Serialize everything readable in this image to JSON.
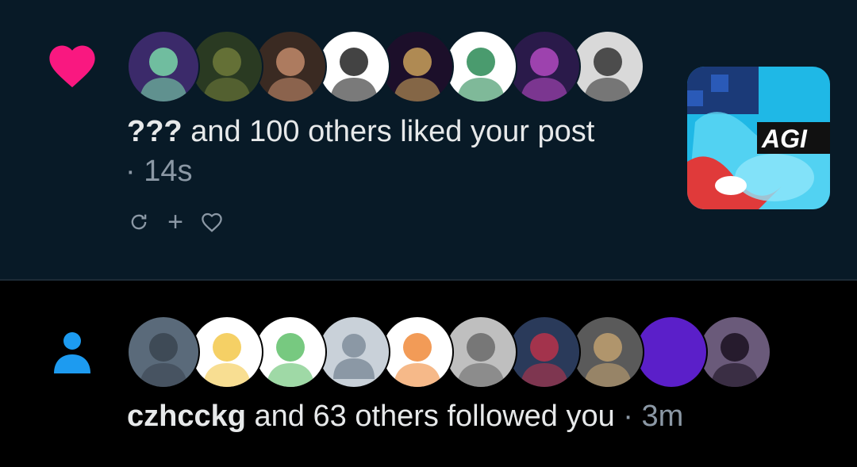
{
  "like_notification": {
    "actor": "???",
    "message": "and 100 others liked your post",
    "time": "· 14s",
    "actions": {
      "repost": "↻",
      "add": "+",
      "like": "♡"
    },
    "avatars": [
      {
        "icon": "avatar-ghost-witch",
        "bg": "#3b2a6a",
        "fg": "#7ad7a8"
      },
      {
        "icon": "avatar-springtrap",
        "bg": "#2a3a22",
        "fg": "#6f7a3a"
      },
      {
        "icon": "avatar-man-standing",
        "bg": "#3a2a22",
        "fg": "#c28a6a"
      },
      {
        "icon": "avatar-sketch-skull",
        "bg": "#ffffff",
        "fg": "#222222"
      },
      {
        "icon": "avatar-monster-grin",
        "bg": "#1c0f2a",
        "fg": "#c9a05a"
      },
      {
        "icon": "avatar-pixel-kid",
        "bg": "#ffffff",
        "fg": "#2a8a55"
      },
      {
        "icon": "avatar-purple-character",
        "bg": "#2a1a4a",
        "fg": "#b24ac0"
      },
      {
        "icon": "avatar-bw-manga",
        "bg": "#d9d9d9",
        "fg": "#333333"
      }
    ],
    "thumbnail_icon": "post-thumbnail-blue-art",
    "thumbnail_text": "AGI"
  },
  "follow_notification": {
    "actor": "czhcckg",
    "message": "and 63 others followed you",
    "time": "· 3m",
    "avatars": [
      {
        "icon": "avatar-dog-statue",
        "bg": "#5a6a7a",
        "fg": "#3a4450"
      },
      {
        "icon": "avatar-blonde-anime",
        "bg": "#ffffff",
        "fg": "#f3c84a"
      },
      {
        "icon": "avatar-gardevoir",
        "bg": "#ffffff",
        "fg": "#5fbf6a"
      },
      {
        "icon": "avatar-default-person",
        "bg": "#c9d1d9",
        "fg": "#8b98a5"
      },
      {
        "icon": "avatar-orange-anime",
        "bg": "#ffffff",
        "fg": "#f08a3a"
      },
      {
        "icon": "avatar-gray-sketch",
        "bg": "#bfbfbf",
        "fg": "#6a6a6a"
      },
      {
        "icon": "avatar-red-striped-legs",
        "bg": "#2a3a5a",
        "fg": "#b8334a"
      },
      {
        "icon": "avatar-half-life",
        "bg": "#5a5a5a",
        "fg": "#c0a070"
      },
      {
        "icon": "avatar-purple-solid",
        "bg": "#5b1fc9",
        "fg": "#5b1fc9"
      },
      {
        "icon": "avatar-dark-hair-anime",
        "bg": "#6a5a7a",
        "fg": "#1a1020"
      }
    ]
  },
  "colors": {
    "heart": "#f91880",
    "person": "#1d9bf0",
    "muted": "#8b98a5",
    "text": "#e7e9ea"
  }
}
